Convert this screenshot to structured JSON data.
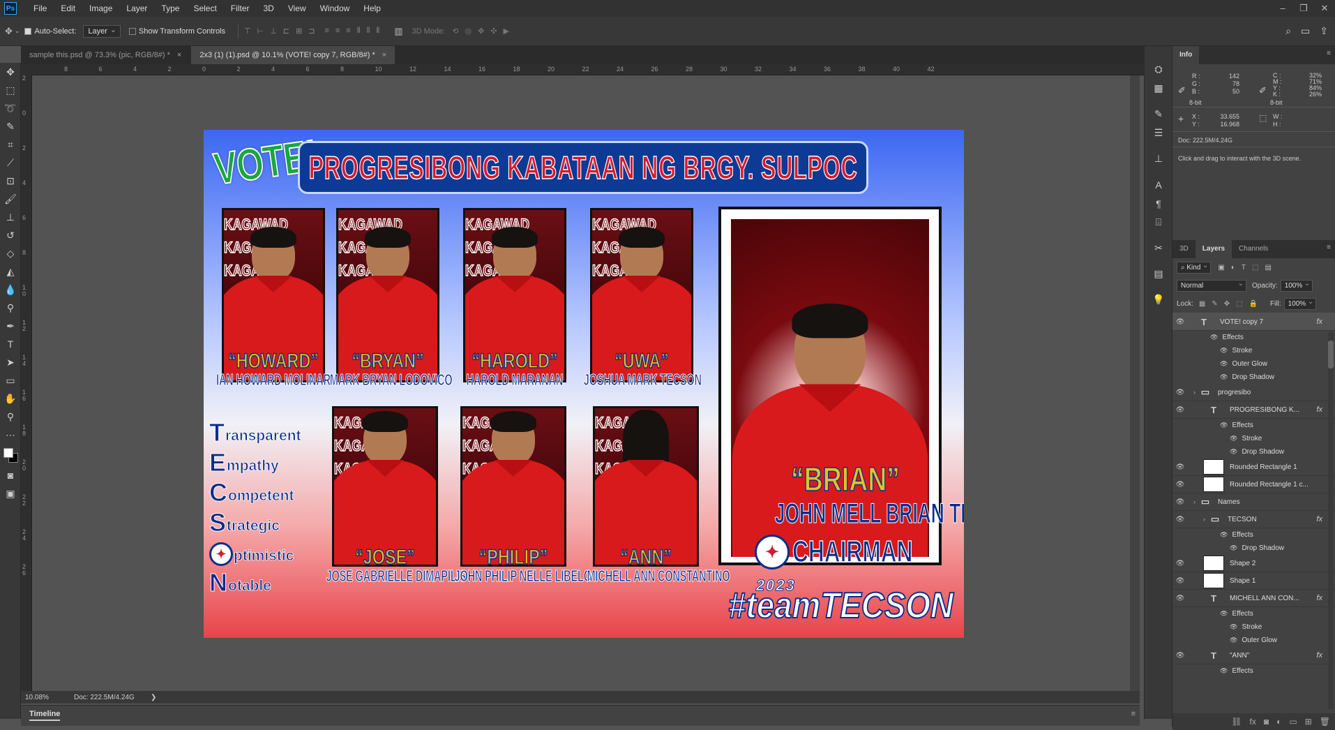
{
  "menubar": {
    "logo": "Ps",
    "items": [
      "File",
      "Edit",
      "Image",
      "Layer",
      "Type",
      "Select",
      "Filter",
      "3D",
      "View",
      "Window",
      "Help"
    ],
    "win_controls": [
      "–",
      "❐",
      "✕"
    ]
  },
  "options": {
    "auto_select_label": "Auto-Select:",
    "auto_select_value": "Layer",
    "transform_label": "Show Transform Controls",
    "mode_3d": "3D Mode:"
  },
  "tabs": [
    {
      "label": "sample this.psd @ 73.3% (pic, RGB/8#) *"
    },
    {
      "label": "2x3 (1) (1).psd @ 10.1% (VOTE! copy 7, RGB/8#) *"
    }
  ],
  "ruler_h": [
    "8",
    "6",
    "4",
    "2",
    "0",
    "2",
    "4",
    "6",
    "8",
    "10",
    "12",
    "14",
    "16",
    "18",
    "20",
    "22",
    "24",
    "26",
    "28",
    "30",
    "32",
    "34",
    "36",
    "38",
    "40",
    "42"
  ],
  "ruler_v": [
    "2",
    "0",
    "2",
    "4",
    "6",
    "8",
    "1 0",
    "1 2",
    "1 4",
    "1 6",
    "1 8",
    "2 0",
    "2 2",
    "2 4",
    "2 6"
  ],
  "status": {
    "zoom": "10.08%",
    "doc": "Doc: 222.5M/4.24G",
    "arrow": "❯"
  },
  "timeline": {
    "label": "Timeline"
  },
  "poster": {
    "vote": "VOTE!",
    "title": "PROGRESIBONG KABATAAN NG BRGY. SULPOC",
    "kagawad": "KAGAWAD",
    "top_row": [
      {
        "nick": "“HOWARD”",
        "name": "IAN HOWARD MOLINAR"
      },
      {
        "nick": "“BRYAN”",
        "name": "MARK BRYAN LODOVICO"
      },
      {
        "nick": "“HAROLD”",
        "name": "HAROLD MARANAN"
      },
      {
        "nick": "“UWA”",
        "name": "JOSHUA MARK TECSON"
      }
    ],
    "bottom_row": [
      {
        "nick": "“JOSE”",
        "name": "JOSE GABRIELLE DIMAPILIS"
      },
      {
        "nick": "“PHILIP”",
        "name": "JOHN PHILIP NELLE LIBELO"
      },
      {
        "nick": "“ANN”",
        "name": "MICHELL ANN CONSTANTINO"
      }
    ],
    "tecson": [
      {
        "cap": "T",
        "rest": "ransparent"
      },
      {
        "cap": "E",
        "rest": "mpathy"
      },
      {
        "cap": "C",
        "rest": "ompetent"
      },
      {
        "cap": "S",
        "rest": "trategic"
      },
      {
        "cap": "O",
        "rest": "ptimistic"
      },
      {
        "cap": "N",
        "rest": "otable"
      }
    ],
    "chair_nick": "“BRIAN”",
    "chair_name": "JOHN MELL BRIAN TECSON",
    "chairman": "CHAIRMAN",
    "year": "2023",
    "hashtag": "#teamTECSON"
  },
  "info": {
    "tab": "Info",
    "rgb": {
      "r": "142",
      "g": "78",
      "b": "50",
      "labels": [
        "R :",
        "G :",
        "B :"
      ]
    },
    "cmyk": {
      "c": "32%",
      "m": "71%",
      "y": "84%",
      "k": "26%",
      "labels": [
        "C :",
        "M :",
        "Y :",
        "K :"
      ]
    },
    "bit_left": "8-bit",
    "bit_right": "8-bit",
    "x": "33.655",
    "y": "16.968",
    "x_label": "X :",
    "y_label": "Y :",
    "w_label": "W :",
    "h_label": "H :",
    "doc": "Doc: 222.5M/4.24G",
    "hint": "Click and drag to interact with the 3D scene."
  },
  "layers_panel": {
    "tabs": [
      "3D",
      "Layers",
      "Channels"
    ],
    "kind": "Kind",
    "blend": "Normal",
    "opacity_label": "Opacity:",
    "opacity": "100%",
    "lock_label": "Lock:",
    "fill_label": "Fill:",
    "fill": "100%",
    "rows": [
      {
        "type": "layer",
        "indent": 0,
        "thumb": "T",
        "name": "VOTE! copy 7",
        "fx": "fx",
        "sel": true
      },
      {
        "type": "effect",
        "indent": 1,
        "name": "Effects"
      },
      {
        "type": "effect",
        "indent": 2,
        "name": "Stroke"
      },
      {
        "type": "effect",
        "indent": 2,
        "name": "Outer Glow"
      },
      {
        "type": "effect",
        "indent": 2,
        "name": "Drop Shadow"
      },
      {
        "type": "group",
        "indent": 0,
        "name": "progresibo"
      },
      {
        "type": "layer",
        "indent": 1,
        "thumb": "T",
        "name": "PROGRESIBONG K...",
        "fx": "fx"
      },
      {
        "type": "effect",
        "indent": 2,
        "name": "Effects"
      },
      {
        "type": "effect",
        "indent": 3,
        "name": "Stroke"
      },
      {
        "type": "effect",
        "indent": 3,
        "name": "Drop Shadow"
      },
      {
        "type": "layer",
        "indent": 1,
        "thumb": "img",
        "name": "Rounded Rectangle 1"
      },
      {
        "type": "layer",
        "indent": 1,
        "thumb": "img",
        "name": "Rounded Rectangle 1 c..."
      },
      {
        "type": "group",
        "indent": 0,
        "name": "Names"
      },
      {
        "type": "group",
        "indent": 1,
        "name": "TECSON",
        "fx": "fx"
      },
      {
        "type": "effect",
        "indent": 2,
        "name": "Effects"
      },
      {
        "type": "effect",
        "indent": 3,
        "name": "Drop Shadow"
      },
      {
        "type": "layer",
        "indent": 1,
        "thumb": "img",
        "name": "Shape 2"
      },
      {
        "type": "layer",
        "indent": 1,
        "thumb": "img",
        "name": "Shape 1"
      },
      {
        "type": "layer",
        "indent": 1,
        "thumb": "T",
        "name": "MICHELL ANN CON...",
        "fx": "fx"
      },
      {
        "type": "effect",
        "indent": 2,
        "name": "Effects"
      },
      {
        "type": "effect",
        "indent": 3,
        "name": "Stroke"
      },
      {
        "type": "effect",
        "indent": 3,
        "name": "Outer Glow"
      },
      {
        "type": "layer",
        "indent": 1,
        "thumb": "T",
        "name": "\"ANN\"",
        "fx": "fx"
      },
      {
        "type": "effect",
        "indent": 2,
        "name": "Effects"
      }
    ]
  },
  "colors": {
    "accent": "#31a8ff",
    "panel": "#383838",
    "poster_blue": "#0c2e8b",
    "poster_red": "#d81a1c",
    "poster_gold": "#e0c22a"
  }
}
